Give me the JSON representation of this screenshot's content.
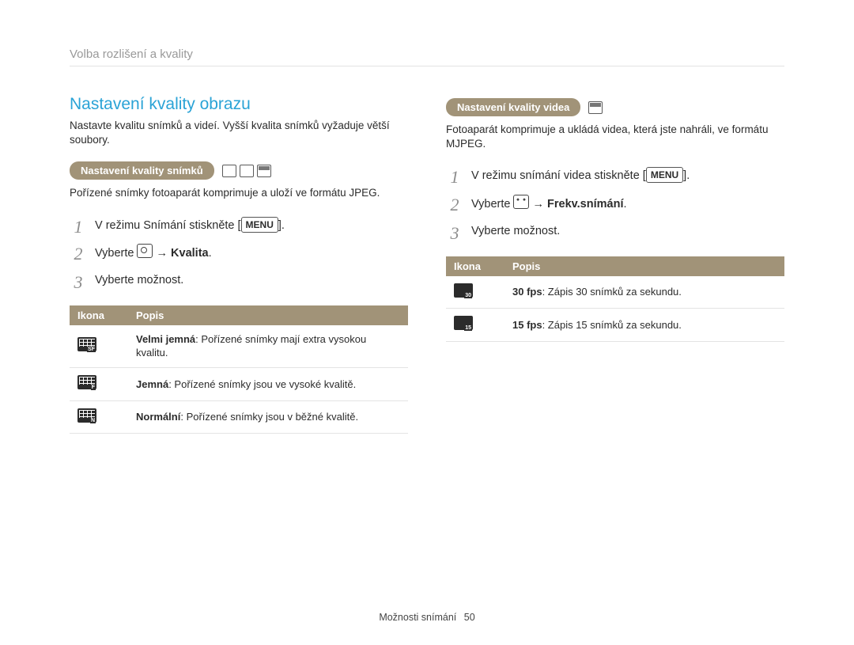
{
  "breadcrumb": "Volba rozlišení a kvality",
  "left": {
    "title": "Nastavení kvality obrazu",
    "intro": "Nastavte kvalitu snímků a videí. Vyšší kvalita snímků vyžaduje větší soubory.",
    "pill": "Nastavení kvality snímků",
    "desc": "Pořízené snímky fotoaparát komprimuje a uloží ve formátu JPEG.",
    "step1_a": "V režimu Snímání stiskněte [",
    "step1_menu": "MENU",
    "step1_b": "].",
    "step2_a": "Vyberte ",
    "step2_arrow": " → ",
    "step2_b": "Kvalita",
    "step2_c": ".",
    "step3": "Vyberte možnost.",
    "th_icon": "Ikona",
    "th_desc": "Popis",
    "rows": [
      {
        "sub": "SF",
        "name": "Velmi jemná",
        "text": ": Pořízené snímky mají extra vysokou kvalitu."
      },
      {
        "sub": "F",
        "name": "Jemná",
        "text": ": Pořízené snímky jsou ve vysoké kvalitě."
      },
      {
        "sub": "N",
        "name": "Normální",
        "text": ": Pořízené snímky jsou v běžné kvalitě."
      }
    ]
  },
  "right": {
    "pill": "Nastavení kvality videa",
    "desc": "Fotoaparát komprimuje a ukládá videa, která jste nahráli, ve formátu MJPEG.",
    "step1_a": "V režimu snímání videa stiskněte [",
    "step1_menu": "MENU",
    "step1_b": "].",
    "step2_a": "Vyberte ",
    "step2_arrow": " → ",
    "step2_b": "Frekv.snímání",
    "step2_c": ".",
    "step3": "Vyberte možnost.",
    "th_icon": "Ikona",
    "th_desc": "Popis",
    "rows": [
      {
        "sub": "30",
        "name": "30 fps",
        "text": ": Zápis 30 snímků za sekundu."
      },
      {
        "sub": "15",
        "name": "15 fps",
        "text": ": Zápis 15 snímků za sekundu."
      }
    ]
  },
  "footer": {
    "section": "Možnosti snímání",
    "page": "50"
  }
}
